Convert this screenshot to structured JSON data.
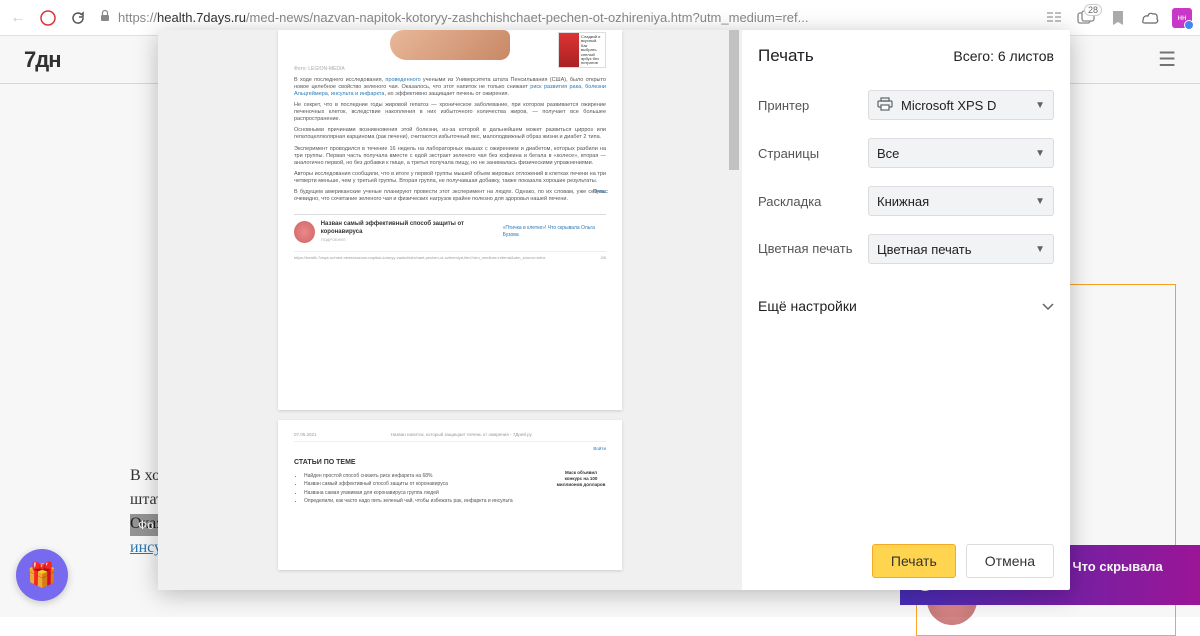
{
  "browser": {
    "url_prefix": "https://",
    "url_domain": "health.7days.ru",
    "url_path": "/med-news/nazvan-napitok-kotoryy-zashchishchaet-pechen-ot-ozhireniya.htm?utm_medium=ref...",
    "tab_badge": "28"
  },
  "page": {
    "logo": "7дн",
    "photo_label": "Фо",
    "article_html": "В хо<br>штата Пенсильвания (США), было открыто новое целебное свойство зеленого чая. Оказалось, что этот напиток не только снижает ",
    "link1": "риск развития рака",
    "link2": "болезни Альцгеймера",
    "link3": "инсульта и инфаркта",
    "article_tail": ", но эффективно защищает печень от ожирения.",
    "sidebar_title": "Назван напиток,",
    "video_promo": "«Птичка в клетке»! Что скрывала Ольга Бузова"
  },
  "print": {
    "title": "Печать",
    "sheets_label": "Всего: 6 листов",
    "rows": {
      "printer": {
        "label": "Принтер",
        "value": "Microsoft XPS D"
      },
      "pages": {
        "label": "Страницы",
        "value": "Все"
      },
      "layout": {
        "label": "Раскладка",
        "value": "Книжная"
      },
      "color": {
        "label": "Цветная печать",
        "value": "Цветная печать"
      }
    },
    "more": "Ещё настройки",
    "buttons": {
      "print": "Печать",
      "cancel": "Отмена"
    }
  },
  "preview": {
    "page1": {
      "credit": "Фото: LEGION-MEDIA",
      "side_thumb_text": "Сладкий и вкусный. Как выбрать спелый арбуз без нитратов",
      "p1a": "В ходе последнего исследования, ",
      "p1link": "проведенного",
      "p1b": " учеными из Университета штата Пенсильвания (США), было открыто новое целебное свойство зеленого чая. Оказалось, что этот напиток не только снижает ",
      "p1links": "риск развития рака, болезни Альцгеймера, инсульта и инфаркта",
      "p1c": ", но эффективно защищает печень от ожирения.",
      "p2": "Не секрет, что в последние годы жировой гепатоз — хроническое заболевание, при котором развивается ожирение печеночных клеток, вследствие накопления в них избыточного количества жиров, — получает все большее распространение.",
      "p3": "Основными причинами возникновения этой болезни, из-за которой в дальнейшем может развиться цирроз или гепатоцеллюлярная карцинома (рак печени), считаются избыточный вес, малоподвижный образ жизни и диабет 2 типа.",
      "p4": "Эксперимент проводился в течение 16 недель на лабораторных мышах с ожирением и диабетом, которых разбили на три группы. Первая часть получала вместе с едой экстракт зеленого чая без кофеина и бегала в «колесе», вторая — аналогично первой, но без добавки к пище, а третья получала пищу, но не занималась физическими упражнениями.",
      "p5": "Авторы исследования сообщили, что в итоге у первой группы мышей объем жировых отложений в клетках печени на три четверти меньше, чем у третьей группы. Вторая группа, не получавшая добавку, также показала хорошие результаты.",
      "p6": "В будущем американские ученые планируют провести этот эксперимент на людях. Однако, по их словам, уже сейчас очевидно, что сочетание зеленого чая и физических нагрузок крайне полезно для здоровья нашей печени.",
      "pulse": "Пульс",
      "rel_title": "Назван самый эффективный способ защиты от коронавируса",
      "rel_sub": "ПОДРОБНЕЕ",
      "rel_side": "«Птичка в клетке»! Что скрывала Ольга Бузова",
      "footer_url": "https://health.7days.ru/med-news/nazvan-napitok-kotoryy-zashchishchaet-pechen-ot-ozhireniya.htm?utm_medium=referral&utm_source=infox",
      "footer_pg": "2/6"
    },
    "page2": {
      "date": "07.06.2021",
      "header_title": "Назван напиток, который защищает печень от ожирения - 7Дней.ру",
      "section": "СТАТЬИ ПО ТЕМЕ",
      "items": [
        "Найден простой способ снизить риск инфаркта на 68%",
        "Назван самый эффективный способ защиты от коронавируса",
        "Названа самая уязвимая для коронавируса группа людей",
        "Определили, как часто надо пить зеленый чай, чтобы избежать рак, инфаркта и инсульта"
      ],
      "side_news": "Маск объявил конкурс на 100 миллионов долларов"
    }
  }
}
